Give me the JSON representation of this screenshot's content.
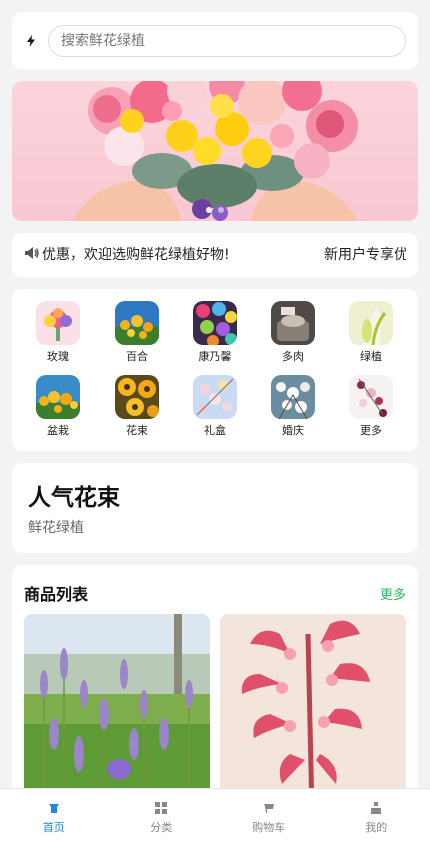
{
  "search": {
    "placeholder": "搜索鲜花绿植"
  },
  "banner": {
    "dots": 2,
    "active_dot": 0
  },
  "notice": {
    "text": "享优惠，欢迎选购鲜花绿植好物!",
    "text_repeat": "新用户专享优惠"
  },
  "categories": [
    {
      "label": "玫瑰",
      "icon": "rose-thumb"
    },
    {
      "label": "百合",
      "icon": "lily-thumb"
    },
    {
      "label": "康乃馨",
      "icon": "carnation-thumb"
    },
    {
      "label": "多肉",
      "icon": "succulent-thumb"
    },
    {
      "label": "绿植",
      "icon": "green-plant-thumb"
    },
    {
      "label": "盆栽",
      "icon": "potted-thumb"
    },
    {
      "label": "花束",
      "icon": "bouquet-thumb"
    },
    {
      "label": "礼盒",
      "icon": "gift-box-thumb"
    },
    {
      "label": "婚庆",
      "icon": "wedding-thumb"
    },
    {
      "label": "更多",
      "icon": "more-thumb"
    }
  ],
  "hot": {
    "title": "人气花束",
    "subtitle": "鲜花绿植"
  },
  "products": {
    "title": "商品列表",
    "more": "更多"
  },
  "tabbar": [
    {
      "label": "首页",
      "icon": "home-icon",
      "active": true
    },
    {
      "label": "分类",
      "icon": "category-icon",
      "active": false
    },
    {
      "label": "购物车",
      "icon": "cart-icon",
      "active": false
    },
    {
      "label": "我的",
      "icon": "user-icon",
      "active": false
    }
  ],
  "colors": {
    "accent": "#1e88e5",
    "more_link": "#2db55d",
    "banner_bg": "#fbd4dc"
  }
}
